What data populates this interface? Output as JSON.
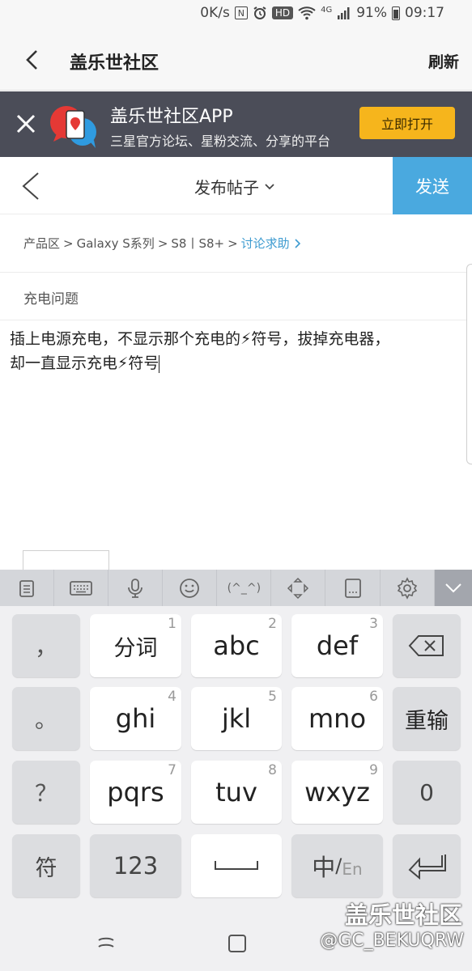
{
  "status_bar": {
    "speed": "0K/s",
    "nfc": "N",
    "hd": "HD",
    "network": "4G",
    "battery_pct": "91%",
    "time": "09:17"
  },
  "browser": {
    "title": "盖乐世社区",
    "refresh_label": "刷新"
  },
  "banner": {
    "title": "盖乐世社区APP",
    "subtitle": "三星官方论坛、星粉交流、分享的平台",
    "open_label": "立即打开"
  },
  "post": {
    "header_title": "发布帖子",
    "send_label": "发送",
    "breadcrumb": [
      "产品区",
      ">",
      "Galaxy S系列",
      ">",
      "S8丨S8+",
      ">",
      "讨论求助"
    ],
    "subject": "充电问题",
    "body_line1": "插上电源充电，不显示那个充电的⚡符号，拔掉充电器，",
    "body_line2": "却一直显示充电⚡符号"
  },
  "keyboard": {
    "toolbar_icons": [
      "clipboard-icon",
      "keyboard-icon",
      "microphone-icon",
      "emoji-icon",
      "kaomoji-icon",
      "cursor-move-icon",
      "handwriting-icon",
      "settings-icon",
      "collapse-icon"
    ],
    "kaomoji_label": "(^_^)",
    "rows": [
      [
        {
          "label": "，"
        },
        {
          "label": "分词",
          "hint": "1"
        },
        {
          "label": "abc",
          "hint": "2"
        },
        {
          "label": "def",
          "hint": "3"
        },
        {
          "label": "backspace"
        }
      ],
      [
        {
          "label": "。"
        },
        {
          "label": "ghi",
          "hint": "4"
        },
        {
          "label": "jkl",
          "hint": "5"
        },
        {
          "label": "mno",
          "hint": "6"
        },
        {
          "label": "重输"
        }
      ],
      [
        {
          "label": "？"
        },
        {
          "label": "pqrs",
          "hint": "7"
        },
        {
          "label": "tuv",
          "hint": "8"
        },
        {
          "label": "wxyz",
          "hint": "9"
        },
        {
          "label": "0"
        }
      ],
      [
        {
          "label": "符"
        },
        {
          "label": "123"
        },
        {
          "label": "space"
        },
        {
          "label": "中/En"
        },
        {
          "label": "enter"
        }
      ]
    ],
    "lang_cn": "中",
    "lang_sep": "/",
    "lang_en": "En"
  },
  "watermark": {
    "line1": "盖乐世社区",
    "line2": "@GC_BEKUQRW"
  }
}
